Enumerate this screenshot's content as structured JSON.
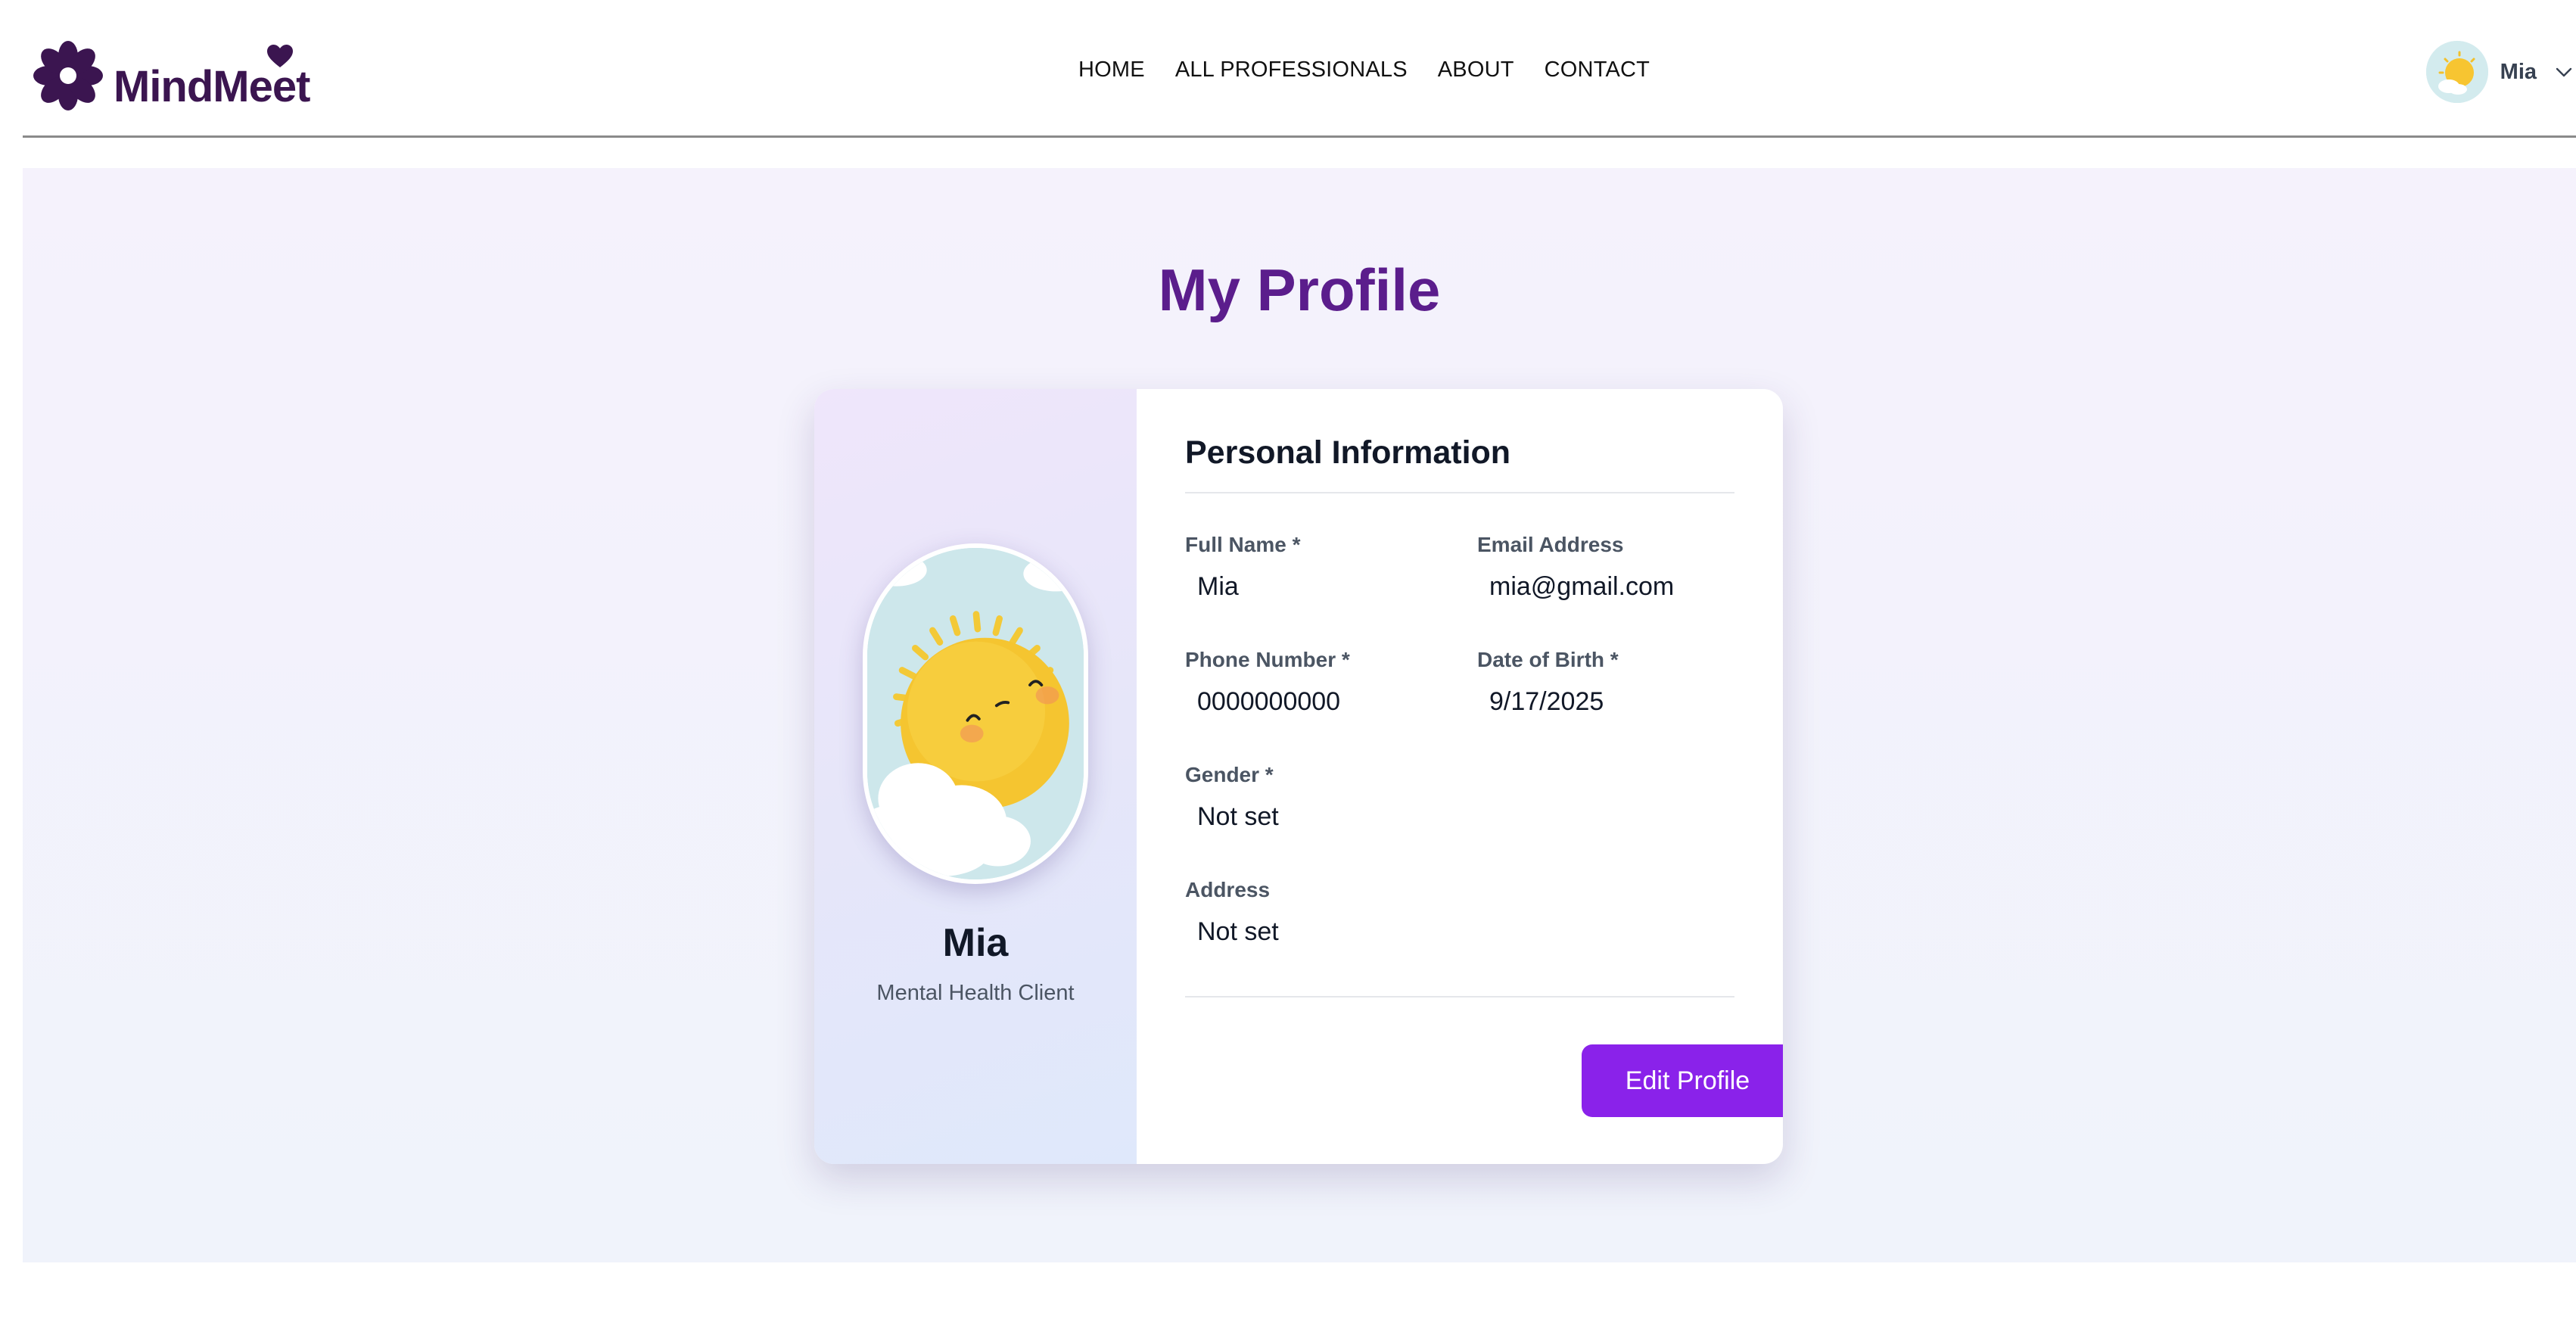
{
  "brand": {
    "name": "MindMeet",
    "logo_icon": "flower-heart-logo-icon",
    "color": "#3b1550"
  },
  "nav": {
    "links": [
      "HOME",
      "ALL PROFESSIONALS",
      "ABOUT",
      "CONTACT"
    ]
  },
  "user_menu": {
    "name": "Mia",
    "avatar_icon": "sun-avatar-icon",
    "dropdown_icon": "chevron-down-icon"
  },
  "page": {
    "title": "My Profile",
    "title_color": "#5b1d8c"
  },
  "profile_card": {
    "name": "Mia",
    "role": "Mental Health Client",
    "section_title": "Personal Information",
    "fields": {
      "full_name": {
        "label": "Full Name *",
        "value": "Mia"
      },
      "email": {
        "label": "Email Address",
        "value": "mia@gmail.com"
      },
      "phone": {
        "label": "Phone Number *",
        "value": "0000000000"
      },
      "dob": {
        "label": "Date of Birth *",
        "value": "9/17/2025"
      },
      "gender": {
        "label": "Gender *",
        "value": "Not set"
      },
      "address": {
        "label": "Address",
        "value": "Not set"
      }
    },
    "edit_button": "Edit Profile",
    "button_color": "#8a22ea"
  }
}
